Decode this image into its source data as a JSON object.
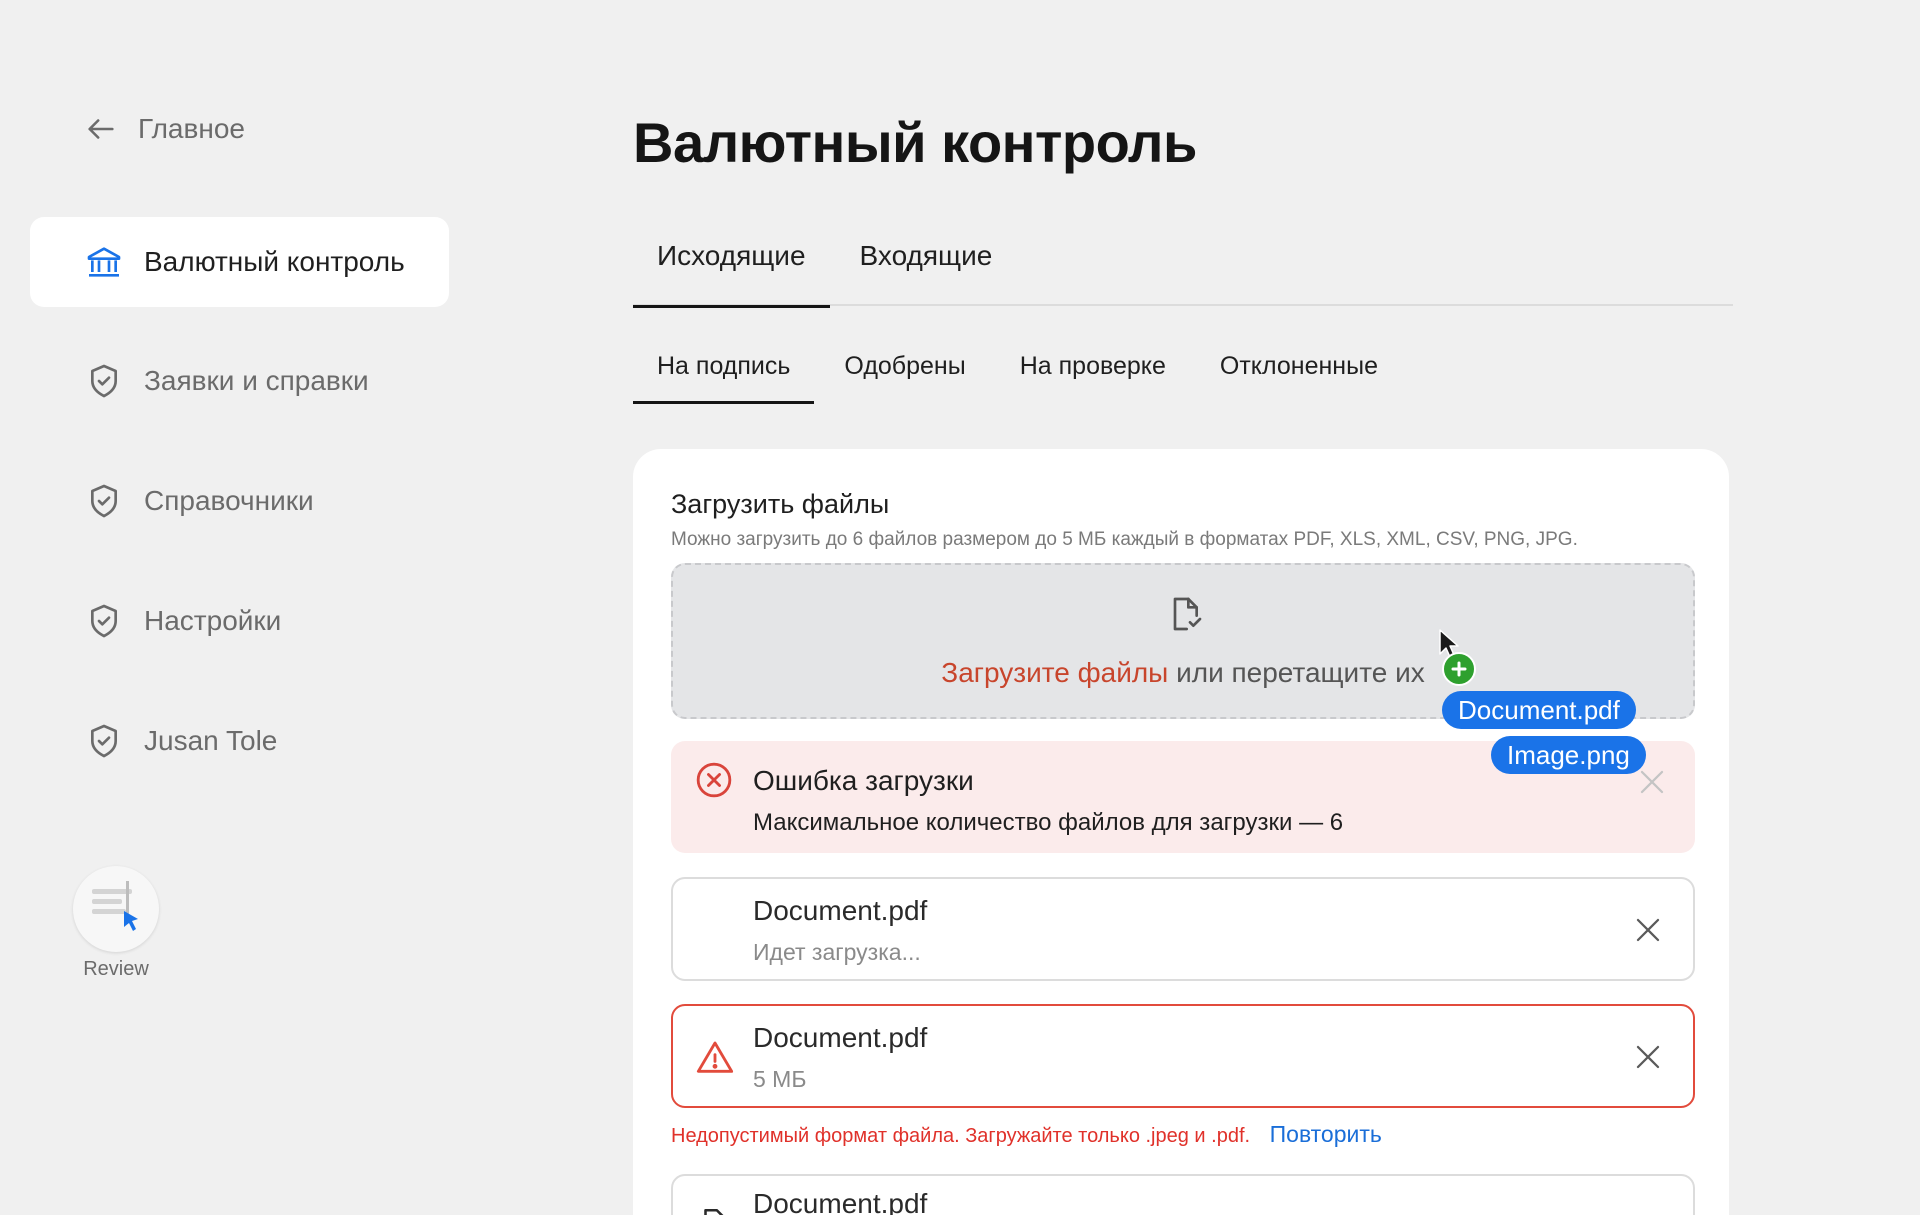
{
  "sidebar": {
    "back_label": "Главное",
    "items": [
      {
        "label": "Валютный контроль",
        "active": true,
        "icon": "bank-icon"
      },
      {
        "label": "Заявки и справки",
        "active": false,
        "icon": "shield-check-icon"
      },
      {
        "label": "Справочники",
        "active": false,
        "icon": "shield-check-icon"
      },
      {
        "label": "Настройки",
        "active": false,
        "icon": "shield-check-icon"
      },
      {
        "label": "Jusan Tole",
        "active": false,
        "icon": "shield-check-icon"
      }
    ],
    "review_label": "Review"
  },
  "main": {
    "title": "Валютный контроль",
    "tabs": [
      {
        "label": "Исходящие",
        "active": true
      },
      {
        "label": "Входящие",
        "active": false
      }
    ],
    "subtabs": [
      {
        "label": "На подпись",
        "active": true
      },
      {
        "label": "Одобрены",
        "active": false
      },
      {
        "label": "На проверке",
        "active": false
      },
      {
        "label": "Отклоненные",
        "active": false
      }
    ]
  },
  "upload": {
    "title": "Загрузить файлы",
    "hint": "Можно загрузить до 6 файлов размером до 5 МБ каждый в форматах PDF, XLS, XML, CSV, PNG, JPG.",
    "dropzone_link": "Загрузите файлы",
    "dropzone_text": "или перетащите их"
  },
  "alert": {
    "title": "Ошибка загрузки",
    "message": "Максимальное количество файлов для загрузки — 6"
  },
  "files": [
    {
      "name": "Document.pdf",
      "status": "Идет загрузка..."
    },
    {
      "name": "Document.pdf",
      "status": "5 МБ"
    },
    {
      "name": "Document.pdf"
    }
  ],
  "file_error": {
    "message": "Недопустимый формат файла. Загружайте только .jpeg и .pdf.",
    "retry": "Повторить"
  },
  "drag": {
    "chips": [
      "Document.pdf",
      "Image.png"
    ]
  },
  "colors": {
    "accent": "#1a73e8",
    "error": "#e24b3c",
    "link_orange": "#c8452c",
    "background": "#f0f0f0"
  }
}
